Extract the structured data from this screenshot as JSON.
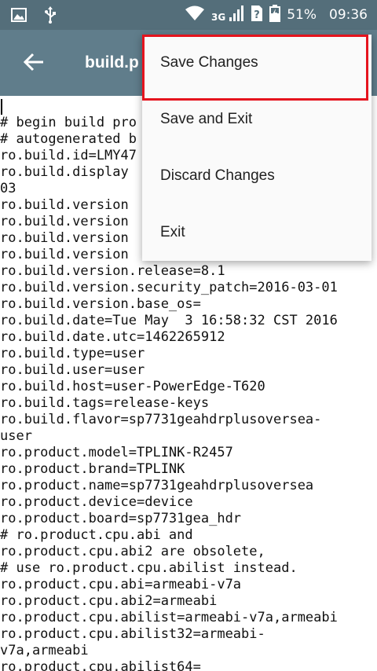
{
  "status_bar": {
    "network": "3G",
    "battery": "51%",
    "time": "09:36",
    "icons": [
      "image-icon",
      "usb-icon",
      "wifi-icon",
      "signal-icon",
      "no-sim-icon",
      "battery-icon"
    ]
  },
  "app_bar": {
    "title": "build.p",
    "back_icon": "arrow-back-icon"
  },
  "menu": {
    "items": [
      {
        "label": "Save Changes"
      },
      {
        "label": "Save and Exit"
      },
      {
        "label": "Discard Changes"
      },
      {
        "label": "Exit"
      }
    ],
    "highlight_color": "#e5141e"
  },
  "editor": {
    "lines": [
      "# begin build pro",
      "# autogenerated b",
      "ro.build.id=LMY47",
      "ro.build.display",
      "03",
      "ro.build.version",
      "ro.build.version",
      "ro.build.version",
      "ro.build.version",
      "ro.build.version.release=8.1",
      "ro.build.version.security_patch=2016-03-01",
      "ro.build.version.base_os=",
      "ro.build.date=Tue May  3 16:58:32 CST 2016",
      "ro.build.date.utc=1462265912",
      "ro.build.type=user",
      "ro.build.user=user",
      "ro.build.host=user-PowerEdge-T620",
      "ro.build.tags=release-keys",
      "ro.build.flavor=sp7731geahdrplusoversea-",
      "user",
      "ro.product.model=TPLINK-R2457",
      "ro.product.brand=TPLINK",
      "ro.product.name=sp7731geahdrplusoversea",
      "ro.product.device=device",
      "ro.product.board=sp7731gea_hdr",
      "# ro.product.cpu.abi and",
      "ro.product.cpu.abi2 are obsolete,",
      "# use ro.product.cpu.abilist instead.",
      "ro.product.cpu.abi=armeabi-v7a",
      "ro.product.cpu.abi2=armeabi",
      "ro.product.cpu.abilist=armeabi-v7a,armeabi",
      "ro.product.cpu.abilist32=armeabi-",
      "v7a,armeabi",
      "ro.product.cpu.abilist64="
    ]
  },
  "colors": {
    "status_bar": "#546e7a",
    "app_bar": "#607d8b",
    "menu_bg": "#fafafa"
  }
}
